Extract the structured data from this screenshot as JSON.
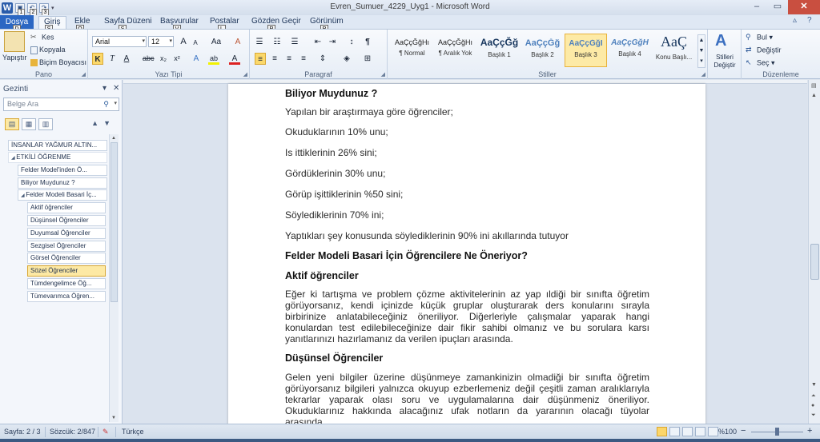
{
  "window": {
    "title": "Evren_Sumuer_4229_Uyg1 - Microsoft Word",
    "min": "–",
    "max": "▭",
    "close": "✕",
    "qat_keytips": [
      "1",
      "2",
      "3"
    ]
  },
  "tabs": [
    {
      "label": "Dosya",
      "keytip": "D"
    },
    {
      "label": "Giriş",
      "keytip": "Ş"
    },
    {
      "label": "Ekle",
      "keytip": "O"
    },
    {
      "label": "Sayfa Düzeni",
      "keytip": "S"
    },
    {
      "label": "Başvurular",
      "keytip": "V"
    },
    {
      "label": "Postalar",
      "keytip": "L"
    },
    {
      "label": "Gözden Geçir",
      "keytip": "R"
    },
    {
      "label": "Görünüm",
      "keytip": "P"
    }
  ],
  "ribbon": {
    "clipboard": {
      "label": "Pano",
      "paste": "Yapıştır",
      "cut": "Kes",
      "copy": "Kopyala",
      "format_painter": "Biçim Boyacısı"
    },
    "font": {
      "label": "Yazı Tipi",
      "font_name": "Arial",
      "font_size": "12",
      "grow": "A",
      "shrink": "A",
      "case": "Aa",
      "clear": "A",
      "bold": "K",
      "italic": "T",
      "underline": "A",
      "strike": "abc",
      "sub": "x₂",
      "sup": "x²",
      "effects": "A",
      "highlight": "ab",
      "color": "A"
    },
    "paragraph": {
      "label": "Paragraf",
      "pilcrow": "¶"
    },
    "styles": {
      "label": "Stiller",
      "items": [
        {
          "sample": "AaÇçĞğHı",
          "name": "¶ Normal"
        },
        {
          "sample": "AaÇçĞğHı",
          "name": "¶ Aralık Yok"
        },
        {
          "sample": "AaÇçĞğ",
          "name": "Başlık 1"
        },
        {
          "sample": "AaÇçĞğ",
          "name": "Başlık 2"
        },
        {
          "sample": "AaÇçĞğI",
          "name": "Başlık 3"
        },
        {
          "sample": "AaÇçĞğH",
          "name": "Başlık 4"
        },
        {
          "sample": "AaÇ",
          "name": "Konu Başlı..."
        }
      ],
      "change_styles": "Stilleri Değiştir"
    },
    "editing": {
      "label": "Düzenleme",
      "find": "Bul",
      "replace": "Değiştir",
      "select": "Seç"
    }
  },
  "nav": {
    "title": "Gezinti",
    "search_placeholder": "Belge Ara",
    "headings": [
      {
        "text": "İNSANLAR YAĞMUR ALTIN...",
        "level": 0,
        "selected": false
      },
      {
        "text": "ETKİLİ ÖĞRENME",
        "level": 0,
        "selected": false,
        "expanded": true
      },
      {
        "text": "Felder Model'inden Ö...",
        "level": 1,
        "selected": false
      },
      {
        "text": "Biliyor Muydunuz ?",
        "level": 1,
        "selected": false
      },
      {
        "text": "Felder Modeli Basari İç...",
        "level": 1,
        "selected": false,
        "expanded": true
      },
      {
        "text": "Aktif öğrenciler",
        "level": 2,
        "selected": false
      },
      {
        "text": "Düşünsel Öğrenciler",
        "level": 2,
        "selected": false
      },
      {
        "text": "Duyumsal Öğrenciler",
        "level": 2,
        "selected": false
      },
      {
        "text": "Sezgisel Öğrenciler",
        "level": 2,
        "selected": false
      },
      {
        "text": "Görsel Öğrenciler",
        "level": 2,
        "selected": false
      },
      {
        "text": "Sözel Öğrenciler",
        "level": 2,
        "selected": true
      },
      {
        "text": "Tümdengelimce Öğ...",
        "level": 2,
        "selected": false
      },
      {
        "text": "Tümevarımca Öğren...",
        "level": 2,
        "selected": false
      }
    ]
  },
  "document": {
    "heading1": "Biliyor Muydunuz ?",
    "lines": [
      "Yapılan  bir araştırmaya  göre öğrenciler;",
      "Okuduklarının  10% unu;",
      "Is ittiklerinin 26% sini;",
      "Gördüklerinin  30% unu;",
      "Görüp işittiklerinin %50 sini;",
      "Söylediklerinin 70% ini;",
      "Yaptıkları  şey konusunda  söylediklerinin 90% ini akıllarında  tutuyor"
    ],
    "heading2": "Felder Modeli Basari İçin Öğrencilere Ne Öneriyor?",
    "heading3": "Aktif öğrenciler",
    "para1": "Eğer ki tartışma ve problem çözme aktivitelerinin az yap ıldiği bir sınıfta öğretim görüyorsanız, kendi içinizde küçük gruplar oluşturarak ders konularını sırayla birbirinize anlatabileceğiniz öneriliyor. Diğerleriyle çalışmalar yaparak hangi konulardan test edilebileceğinize dair fikir sahibi olmanız ve bu sorulara karsı yanıtlarınızı hazırlamanız da verilen ipuçları arasında.",
    "heading4": "Düşünsel Öğrenciler",
    "para2": "Gelen yeni bilgiler üzerine düşünmeye zamankinizin olmadiği bir sınıfta öğretim görüyorsanız bilgileri yalnızca okuyup ezberlemeniz değil çeşitli zaman aralıklarıyla tekrarlar yaparak olası soru ve uygulamalarına dair düşünmeniz öneriliyor. Okuduklarınız hakkında alacağınız ufak notların da yararının olacağı tüyolar arasında."
  },
  "status": {
    "page": "Sayfa: 2 / 3",
    "words": "Sözcük: 2/847",
    "language": "Türkçe",
    "zoom": "%100",
    "zoom_out": "−",
    "zoom_in": "+"
  }
}
